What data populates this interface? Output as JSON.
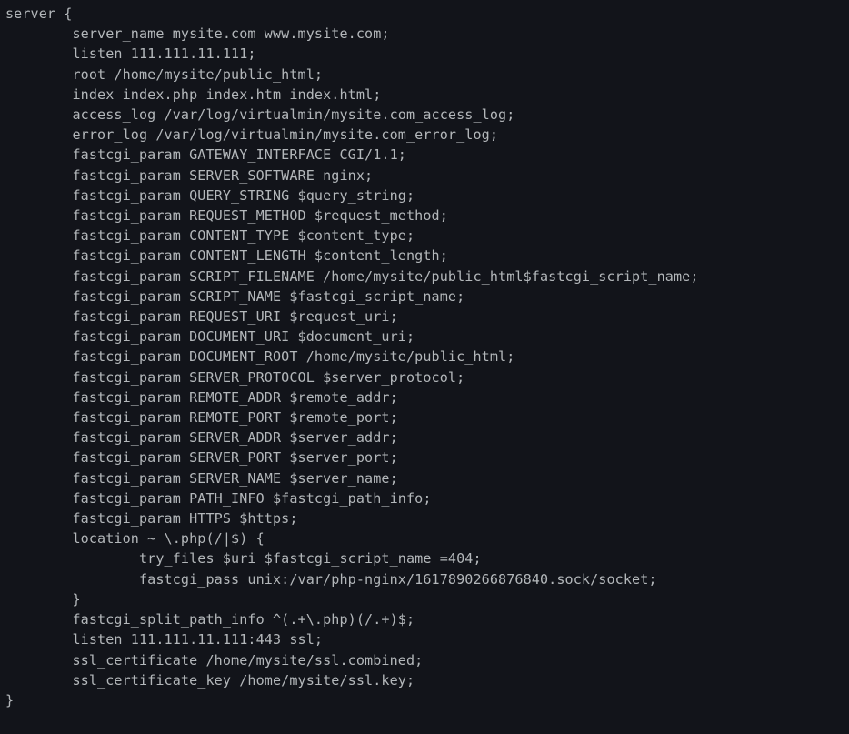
{
  "config": {
    "lines": [
      "server {",
      "        server_name mysite.com www.mysite.com;",
      "        listen 111.111.11.111;",
      "        root /home/mysite/public_html;",
      "        index index.php index.htm index.html;",
      "        access_log /var/log/virtualmin/mysite.com_access_log;",
      "        error_log /var/log/virtualmin/mysite.com_error_log;",
      "        fastcgi_param GATEWAY_INTERFACE CGI/1.1;",
      "        fastcgi_param SERVER_SOFTWARE nginx;",
      "        fastcgi_param QUERY_STRING $query_string;",
      "        fastcgi_param REQUEST_METHOD $request_method;",
      "        fastcgi_param CONTENT_TYPE $content_type;",
      "        fastcgi_param CONTENT_LENGTH $content_length;",
      "        fastcgi_param SCRIPT_FILENAME /home/mysite/public_html$fastcgi_script_name;",
      "        fastcgi_param SCRIPT_NAME $fastcgi_script_name;",
      "        fastcgi_param REQUEST_URI $request_uri;",
      "        fastcgi_param DOCUMENT_URI $document_uri;",
      "        fastcgi_param DOCUMENT_ROOT /home/mysite/public_html;",
      "        fastcgi_param SERVER_PROTOCOL $server_protocol;",
      "        fastcgi_param REMOTE_ADDR $remote_addr;",
      "        fastcgi_param REMOTE_PORT $remote_port;",
      "        fastcgi_param SERVER_ADDR $server_addr;",
      "        fastcgi_param SERVER_PORT $server_port;",
      "        fastcgi_param SERVER_NAME $server_name;",
      "        fastcgi_param PATH_INFO $fastcgi_path_info;",
      "        fastcgi_param HTTPS $https;",
      "        location ~ \\.php(/|$) {",
      "                try_files $uri $fastcgi_script_name =404;",
      "                fastcgi_pass unix:/var/php-nginx/1617890266876840.sock/socket;",
      "        }",
      "        fastcgi_split_path_info ^(.+\\.php)(/.+)$;",
      "        listen 111.111.11.111:443 ssl;",
      "        ssl_certificate /home/mysite/ssl.combined;",
      "        ssl_certificate_key /home/mysite/ssl.key;",
      "}"
    ]
  }
}
